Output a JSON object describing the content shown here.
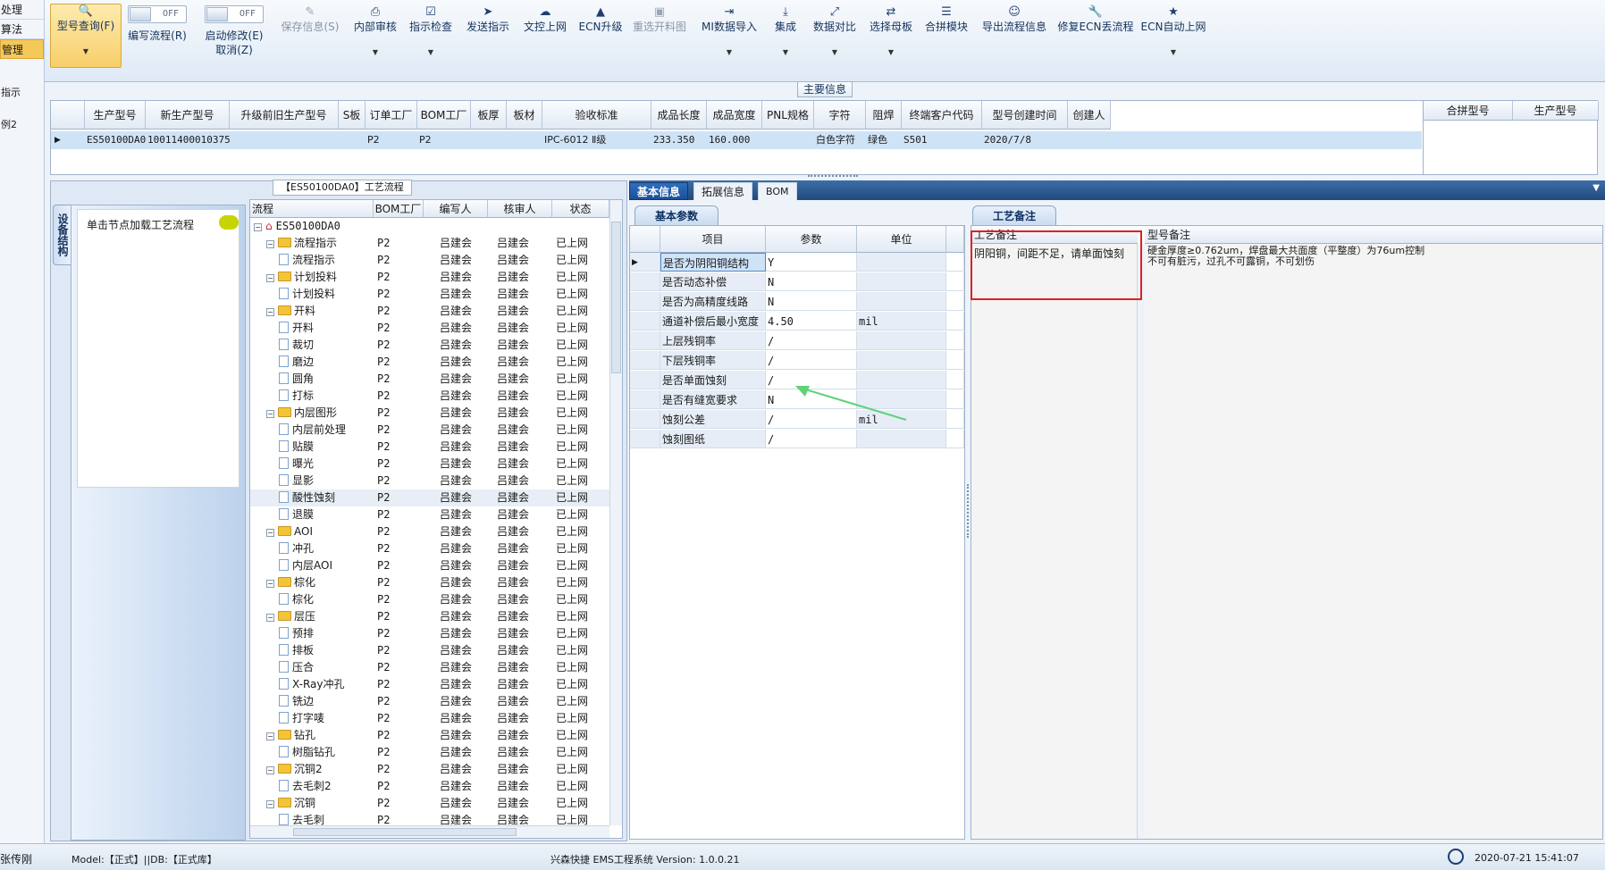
{
  "left_nav": {
    "items": [
      "处理",
      "算法",
      "管理"
    ],
    "sub_items": [
      "指示",
      "例2"
    ]
  },
  "toolbar": {
    "model_query": "型号查询(F)",
    "write_flow": "编写流程(R)",
    "start_modify": "启动修改(E)",
    "cancel": "取消(Z)",
    "toggle_off": "OFF",
    "save_info": "保存信息(S)",
    "internal_review": "内部审核",
    "instruction_check": "指示检查",
    "send_instruction": "发送指示",
    "doc_upload": "文控上网",
    "ecn_upgrade": "ECN升级",
    "reselect_image": "重选开料图",
    "mi_import": "MI数据导入",
    "integrate": "集成",
    "data_compare": "数据对比",
    "select_mother": "选择母板",
    "merge_module": "合拼模块",
    "export_flow": "导出流程信息",
    "repair_ecn": "修复ECN丢流程",
    "ecn_auto_upload": "ECN自动上网"
  },
  "main_info": {
    "section_label": "主要信息",
    "headers": [
      "生产型号",
      "新生产型号",
      "升级前旧生产型号",
      "S板",
      "订单工厂",
      "BOM工厂",
      "板厚",
      "板材",
      "验收标准",
      "成品长度",
      "成品宽度",
      "PNL规格",
      "字符",
      "阻焊",
      "终端客户代码",
      "型号创建时间",
      "创建人"
    ],
    "row": [
      "ES50100DA0",
      "10011400010375",
      "",
      "",
      "P2",
      "P2",
      "",
      "",
      "IPC-6012 Ⅱ级",
      "233.350",
      "160.000",
      "",
      "白色字符",
      "绿色",
      "S501",
      "2020/7/8",
      ""
    ],
    "side_headers": [
      "合拼型号",
      "生产型号"
    ]
  },
  "flow_panel": {
    "title": "【ES50100DA0】工艺流程",
    "vertical_tab": "设备结构",
    "hint": "单击节点加载工艺流程",
    "headers": [
      "流程",
      "BOM工厂",
      "编写人",
      "核审人",
      "状态"
    ],
    "rows": [
      {
        "level": 0,
        "type": "root",
        "name": "ES50100DA0",
        "bom": "",
        "writer": "",
        "reviewer": "",
        "status": ""
      },
      {
        "level": 1,
        "type": "folder",
        "name": "流程指示",
        "bom": "P2",
        "writer": "吕建会",
        "reviewer": "吕建会",
        "status": "已上网"
      },
      {
        "level": 2,
        "type": "doc",
        "name": "流程指示",
        "bom": "P2",
        "writer": "吕建会",
        "reviewer": "吕建会",
        "status": "已上网"
      },
      {
        "level": 1,
        "type": "folder",
        "name": "计划投料",
        "bom": "P2",
        "writer": "吕建会",
        "reviewer": "吕建会",
        "status": "已上网"
      },
      {
        "level": 2,
        "type": "doc",
        "name": "计划投料",
        "bom": "P2",
        "writer": "吕建会",
        "reviewer": "吕建会",
        "status": "已上网"
      },
      {
        "level": 1,
        "type": "folder",
        "name": "开料",
        "bom": "P2",
        "writer": "吕建会",
        "reviewer": "吕建会",
        "status": "已上网"
      },
      {
        "level": 2,
        "type": "doc",
        "name": "开料",
        "bom": "P2",
        "writer": "吕建会",
        "reviewer": "吕建会",
        "status": "已上网"
      },
      {
        "level": 2,
        "type": "doc",
        "name": "裁切",
        "bom": "P2",
        "writer": "吕建会",
        "reviewer": "吕建会",
        "status": "已上网"
      },
      {
        "level": 2,
        "type": "doc",
        "name": "磨边",
        "bom": "P2",
        "writer": "吕建会",
        "reviewer": "吕建会",
        "status": "已上网"
      },
      {
        "level": 2,
        "type": "doc",
        "name": "圆角",
        "bom": "P2",
        "writer": "吕建会",
        "reviewer": "吕建会",
        "status": "已上网"
      },
      {
        "level": 2,
        "type": "doc",
        "name": "打标",
        "bom": "P2",
        "writer": "吕建会",
        "reviewer": "吕建会",
        "status": "已上网"
      },
      {
        "level": 1,
        "type": "folder",
        "name": "内层图形",
        "bom": "P2",
        "writer": "吕建会",
        "reviewer": "吕建会",
        "status": "已上网"
      },
      {
        "level": 2,
        "type": "doc",
        "name": "内层前处理",
        "bom": "P2",
        "writer": "吕建会",
        "reviewer": "吕建会",
        "status": "已上网"
      },
      {
        "level": 2,
        "type": "doc",
        "name": "贴膜",
        "bom": "P2",
        "writer": "吕建会",
        "reviewer": "吕建会",
        "status": "已上网"
      },
      {
        "level": 2,
        "type": "doc",
        "name": "曝光",
        "bom": "P2",
        "writer": "吕建会",
        "reviewer": "吕建会",
        "status": "已上网"
      },
      {
        "level": 2,
        "type": "doc",
        "name": "显影",
        "bom": "P2",
        "writer": "吕建会",
        "reviewer": "吕建会",
        "status": "已上网"
      },
      {
        "level": 2,
        "type": "doc",
        "name": "酸性蚀刻",
        "bom": "P2",
        "writer": "吕建会",
        "reviewer": "吕建会",
        "status": "已上网",
        "selected": true
      },
      {
        "level": 2,
        "type": "doc",
        "name": "退膜",
        "bom": "P2",
        "writer": "吕建会",
        "reviewer": "吕建会",
        "status": "已上网"
      },
      {
        "level": 1,
        "type": "folder",
        "name": "AOI",
        "bom": "P2",
        "writer": "吕建会",
        "reviewer": "吕建会",
        "status": "已上网"
      },
      {
        "level": 2,
        "type": "doc",
        "name": "冲孔",
        "bom": "P2",
        "writer": "吕建会",
        "reviewer": "吕建会",
        "status": "已上网"
      },
      {
        "level": 2,
        "type": "doc",
        "name": "内层AOI",
        "bom": "P2",
        "writer": "吕建会",
        "reviewer": "吕建会",
        "status": "已上网"
      },
      {
        "level": 1,
        "type": "folder",
        "name": "棕化",
        "bom": "P2",
        "writer": "吕建会",
        "reviewer": "吕建会",
        "status": "已上网"
      },
      {
        "level": 2,
        "type": "doc",
        "name": "棕化",
        "bom": "P2",
        "writer": "吕建会",
        "reviewer": "吕建会",
        "status": "已上网"
      },
      {
        "level": 1,
        "type": "folder",
        "name": "层压",
        "bom": "P2",
        "writer": "吕建会",
        "reviewer": "吕建会",
        "status": "已上网"
      },
      {
        "level": 2,
        "type": "doc",
        "name": "预排",
        "bom": "P2",
        "writer": "吕建会",
        "reviewer": "吕建会",
        "status": "已上网"
      },
      {
        "level": 2,
        "type": "doc",
        "name": "排板",
        "bom": "P2",
        "writer": "吕建会",
        "reviewer": "吕建会",
        "status": "已上网"
      },
      {
        "level": 2,
        "type": "doc",
        "name": "压合",
        "bom": "P2",
        "writer": "吕建会",
        "reviewer": "吕建会",
        "status": "已上网"
      },
      {
        "level": 2,
        "type": "doc",
        "name": "X-Ray冲孔",
        "bom": "P2",
        "writer": "吕建会",
        "reviewer": "吕建会",
        "status": "已上网"
      },
      {
        "level": 2,
        "type": "doc",
        "name": "铣边",
        "bom": "P2",
        "writer": "吕建会",
        "reviewer": "吕建会",
        "status": "已上网"
      },
      {
        "level": 2,
        "type": "doc",
        "name": "打字唛",
        "bom": "P2",
        "writer": "吕建会",
        "reviewer": "吕建会",
        "status": "已上网"
      },
      {
        "level": 1,
        "type": "folder",
        "name": "钻孔",
        "bom": "P2",
        "writer": "吕建会",
        "reviewer": "吕建会",
        "status": "已上网"
      },
      {
        "level": 2,
        "type": "doc",
        "name": "树脂钻孔",
        "bom": "P2",
        "writer": "吕建会",
        "reviewer": "吕建会",
        "status": "已上网"
      },
      {
        "level": 1,
        "type": "folder",
        "name": "沉铜2",
        "bom": "P2",
        "writer": "吕建会",
        "reviewer": "吕建会",
        "status": "已上网"
      },
      {
        "level": 2,
        "type": "doc",
        "name": "去毛刺2",
        "bom": "P2",
        "writer": "吕建会",
        "reviewer": "吕建会",
        "status": "已上网"
      },
      {
        "level": 1,
        "type": "folder",
        "name": "沉铜",
        "bom": "P2",
        "writer": "吕建会",
        "reviewer": "吕建会",
        "status": "已上网"
      },
      {
        "level": 2,
        "type": "doc",
        "name": "去毛刺",
        "bom": "P2",
        "writer": "吕建会",
        "reviewer": "吕建会",
        "status": "已上网"
      }
    ]
  },
  "info_tabs": [
    "基本信息",
    "拓展信息",
    "BOM"
  ],
  "basic_params": {
    "title": "基本参数",
    "headers": [
      "项目",
      "参数",
      "单位"
    ],
    "rows": [
      {
        "item": "是否为阴阳铜结构",
        "value": "Y",
        "unit": ""
      },
      {
        "item": "是否动态补偿",
        "value": "N",
        "unit": ""
      },
      {
        "item": "是否为高精度线路",
        "value": "N",
        "unit": ""
      },
      {
        "item": "通道补偿后最小宽度",
        "value": "4.50",
        "unit": "mil"
      },
      {
        "item": "上层残铜率",
        "value": "/",
        "unit": ""
      },
      {
        "item": "下层残铜率",
        "value": "/",
        "unit": ""
      },
      {
        "item": "是否单面蚀刻",
        "value": "/",
        "unit": ""
      },
      {
        "item": "是否有缝宽要求",
        "value": "N",
        "unit": ""
      },
      {
        "item": "蚀刻公差",
        "value": "/",
        "unit": "mil"
      },
      {
        "item": "蚀刻图纸",
        "value": "/",
        "unit": ""
      }
    ]
  },
  "process_notes": {
    "title": "工艺备注",
    "col1_header": "工艺备注",
    "col1_text": "阴阳铜，间距不足，请单面蚀刻",
    "col2_header": "型号备注",
    "col2_text": "硬金厚度≥0.762um，焊盘最大共面度（平整度）为76um控制\n不可有脏污，过孔不可露铜，不可划伤"
  },
  "status_bar": {
    "user": "张传刚",
    "model": "Model:【正式】||DB:【正式库】",
    "system": "兴森快捷 EMS工程系统 Version: 1.0.0.21",
    "datetime": "2020-07-21 15:41:07"
  },
  "colors": {
    "highlight_box": "#e02020",
    "arrow": "#5fd27a",
    "selected_row": "#cfe3f7",
    "tab_active": "#1b4f97"
  }
}
